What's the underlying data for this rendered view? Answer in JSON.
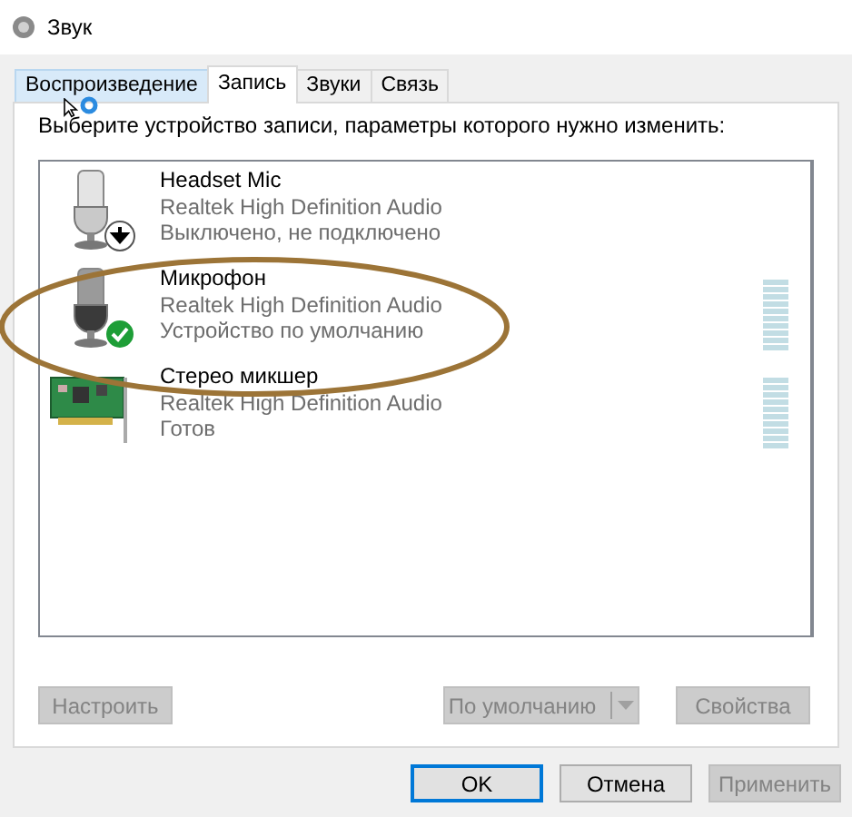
{
  "window": {
    "title": "Звук"
  },
  "tabs": [
    {
      "label": "Воспроизведение",
      "selected": false
    },
    {
      "label": "Запись",
      "selected": true
    },
    {
      "label": "Звуки",
      "selected": false
    },
    {
      "label": "Связь",
      "selected": false
    }
  ],
  "instruction": "Выберите устройство записи, параметры которого нужно изменить:",
  "devices": [
    {
      "name": "Headset Mic",
      "driver": "Realtek High Definition Audio",
      "status": "Выключено, не подключено",
      "kind": "microphone",
      "default": false,
      "disconnected": true
    },
    {
      "name": "Микрофон",
      "driver": "Realtek High Definition Audio",
      "status": "Устройство по умолчанию",
      "kind": "microphone",
      "default": true,
      "disconnected": false
    },
    {
      "name": "Стерео микшер",
      "driver": "Realtek High Definition Audio",
      "status": "Готов",
      "kind": "sound-card",
      "default": false,
      "disconnected": false
    }
  ],
  "panel_buttons": [
    {
      "label": "Настроить",
      "kind": "plain",
      "disabled": true
    },
    {
      "label": "По умолчанию",
      "kind": "split",
      "disabled": true
    },
    {
      "label": "Свойства",
      "kind": "plain",
      "disabled": true
    }
  ],
  "dialog_buttons": [
    {
      "label": "OK",
      "default": true,
      "disabled": false
    },
    {
      "label": "Отмена",
      "default": false,
      "disabled": false
    },
    {
      "label": "Применить",
      "default": false,
      "disabled": true
    }
  ]
}
